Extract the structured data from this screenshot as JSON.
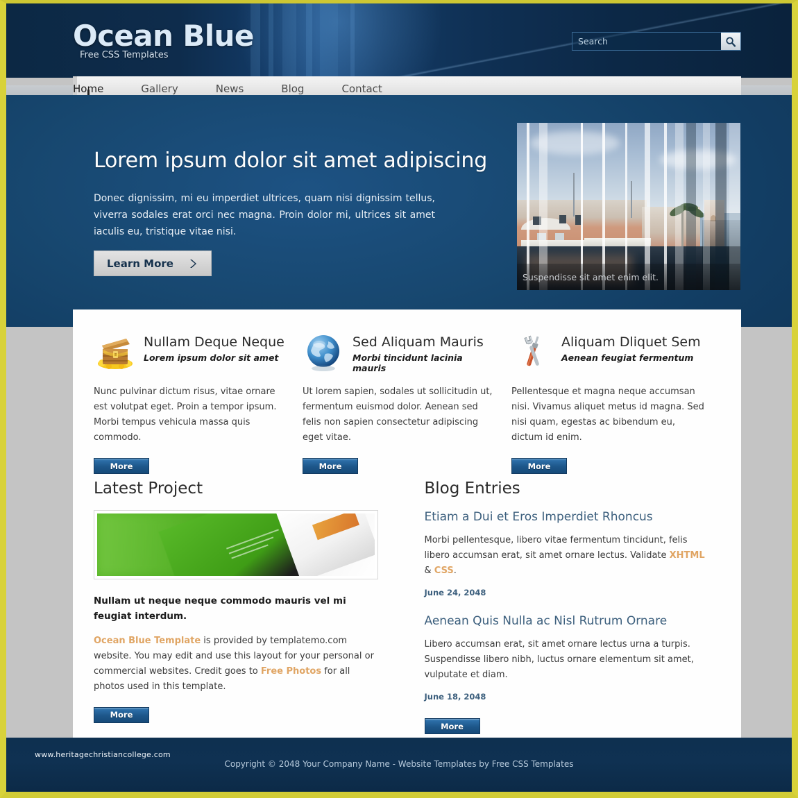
{
  "brand": {
    "title": "Ocean Blue",
    "slogan": "Free CSS Templates"
  },
  "search": {
    "placeholder": "Search",
    "value": "",
    "button_icon": "search-icon"
  },
  "nav": {
    "items": [
      {
        "label": "Home",
        "active": true
      },
      {
        "label": "Gallery",
        "active": false
      },
      {
        "label": "News",
        "active": false
      },
      {
        "label": "Blog",
        "active": false
      },
      {
        "label": "Contact",
        "active": false
      }
    ]
  },
  "hero": {
    "title": "Lorem ipsum dolor sit amet adipiscing",
    "text": "Donec dignissim, mi eu imperdiet ultrices, quam nisi dignissim tellus, viverra sodales erat orci nec magna. Proin dolor mi, ultrices sit amet iaculis eu, tristique vitae nisi.",
    "button_label": "Learn More",
    "button_icon": "chevron-right-icon",
    "image_caption": "Suspendisse sit amet enim elit."
  },
  "features": [
    {
      "icon": "treasure-chest-icon",
      "title": "Nullam Deque Neque",
      "subtitle": "Lorem ipsum dolor sit amet",
      "body": "Nunc pulvinar dictum risus, vitae ornare est volutpat eget. Proin a tempor ipsum. Morbi tempus vehicula massa quis commodo.",
      "button_label": "More"
    },
    {
      "icon": "globe-icon",
      "title": "Sed Aliquam Mauris",
      "subtitle": "Morbi tincidunt lacinia mauris",
      "body": "Ut lorem sapien, sodales ut sollicitudin ut, fermentum euismod dolor. Aenean sed felis non sapien consectetur adipiscing eget vitae.",
      "button_label": "More"
    },
    {
      "icon": "tools-icon",
      "title": "Aliquam Dliquet Sem",
      "subtitle": "Aenean feugiat fermentum",
      "body": "Pellentesque et magna neque accumsan nisi. Vivamus aliquet metus id magna. Sed nisi quam, egestas ac bibendum eu, dictum id enim.",
      "button_label": "More"
    }
  ],
  "project": {
    "section_title": "Latest Project",
    "image_alt": "green-website-mockup",
    "headline": "Nullam ut neque neque commodo mauris vel mi feugiat interdum.",
    "body_link_1": "Ocean Blue Template",
    "body_part_1": " is provided by templatemo.com website. You may edit and use this layout for your personal or commercial websites. Credit goes to ",
    "body_link_2": "Free Photos",
    "body_part_2": " for all photos used in this template.",
    "button_label": "More"
  },
  "blog": {
    "section_title": "Blog Entries",
    "entries": [
      {
        "title": "Etiam a Dui et Eros Imperdiet Rhoncus",
        "body_part_1": "Morbi pellentesque, libero vitae fermentum tincidunt, felis libero accumsan erat, sit amet ornare lectus. Validate ",
        "link_1": "XHTML",
        "body_part_2": " & ",
        "link_2": "CSS",
        "body_part_3": ".",
        "date": "June 24, 2048"
      },
      {
        "title": "Aenean Quis Nulla ac Nisl Rutrum Ornare",
        "body_part_1": "Libero accumsan erat, sit amet ornare lectus urna a turpis. Suspendisse libero nibh, luctus ornare elementum sit amet, vulputate et diam.",
        "link_1": "",
        "body_part_2": "",
        "link_2": "",
        "body_part_3": "",
        "date": "June 18, 2048"
      }
    ],
    "button_label": "More"
  },
  "footer": {
    "copyright": "Copyright © 2048 Your Company Name - Website Templates by Free CSS Templates",
    "watermark": "www.heritagechristiancollege.com"
  },
  "colors": {
    "frame": "#d8d23a",
    "header_navy": "#0b2640",
    "hero_blue": "#17476f",
    "page_gray": "#c4c4c4",
    "link_orange": "#e0a564",
    "blog_blue": "#3c5f7d",
    "button_blue": "#1d5689"
  }
}
